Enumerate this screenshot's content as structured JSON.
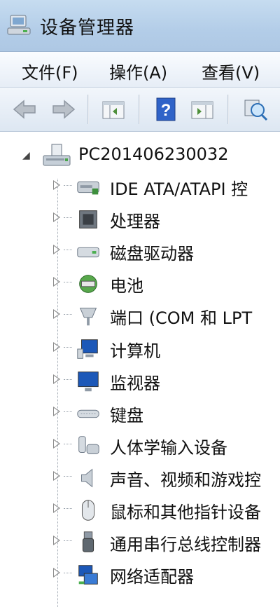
{
  "window": {
    "title": "设备管理器"
  },
  "menu": [
    {
      "label": "文件(F)"
    },
    {
      "label": "操作(A)"
    },
    {
      "label": "查看(V)"
    }
  ],
  "toolbar_icons": [
    "back-arrow-icon",
    "forward-arrow-icon",
    "console-tree-icon",
    "help-icon",
    "action-pane-icon",
    "scan-hardware-icon"
  ],
  "tree": {
    "root": {
      "label": "PC201406230032",
      "expanded": true
    },
    "nodes": [
      {
        "label": "IDE ATA/ATAPI 控",
        "icon": "ide-controller-icon"
      },
      {
        "label": "处理器",
        "icon": "processor-icon"
      },
      {
        "label": "磁盘驱动器",
        "icon": "disk-drive-icon"
      },
      {
        "label": "电池",
        "icon": "battery-icon"
      },
      {
        "label": "端口 (COM 和 LPT",
        "icon": "port-icon"
      },
      {
        "label": "计算机",
        "icon": "computer-icon"
      },
      {
        "label": "监视器",
        "icon": "monitor-icon"
      },
      {
        "label": "键盘",
        "icon": "keyboard-icon"
      },
      {
        "label": "人体学输入设备",
        "icon": "hid-icon"
      },
      {
        "label": "声音、视频和游戏控",
        "icon": "sound-icon"
      },
      {
        "label": "鼠标和其他指针设备",
        "icon": "mouse-icon"
      },
      {
        "label": "通用串行总线控制器",
        "icon": "usb-icon"
      },
      {
        "label": "网络适配器",
        "icon": "network-adapter-icon"
      }
    ]
  }
}
